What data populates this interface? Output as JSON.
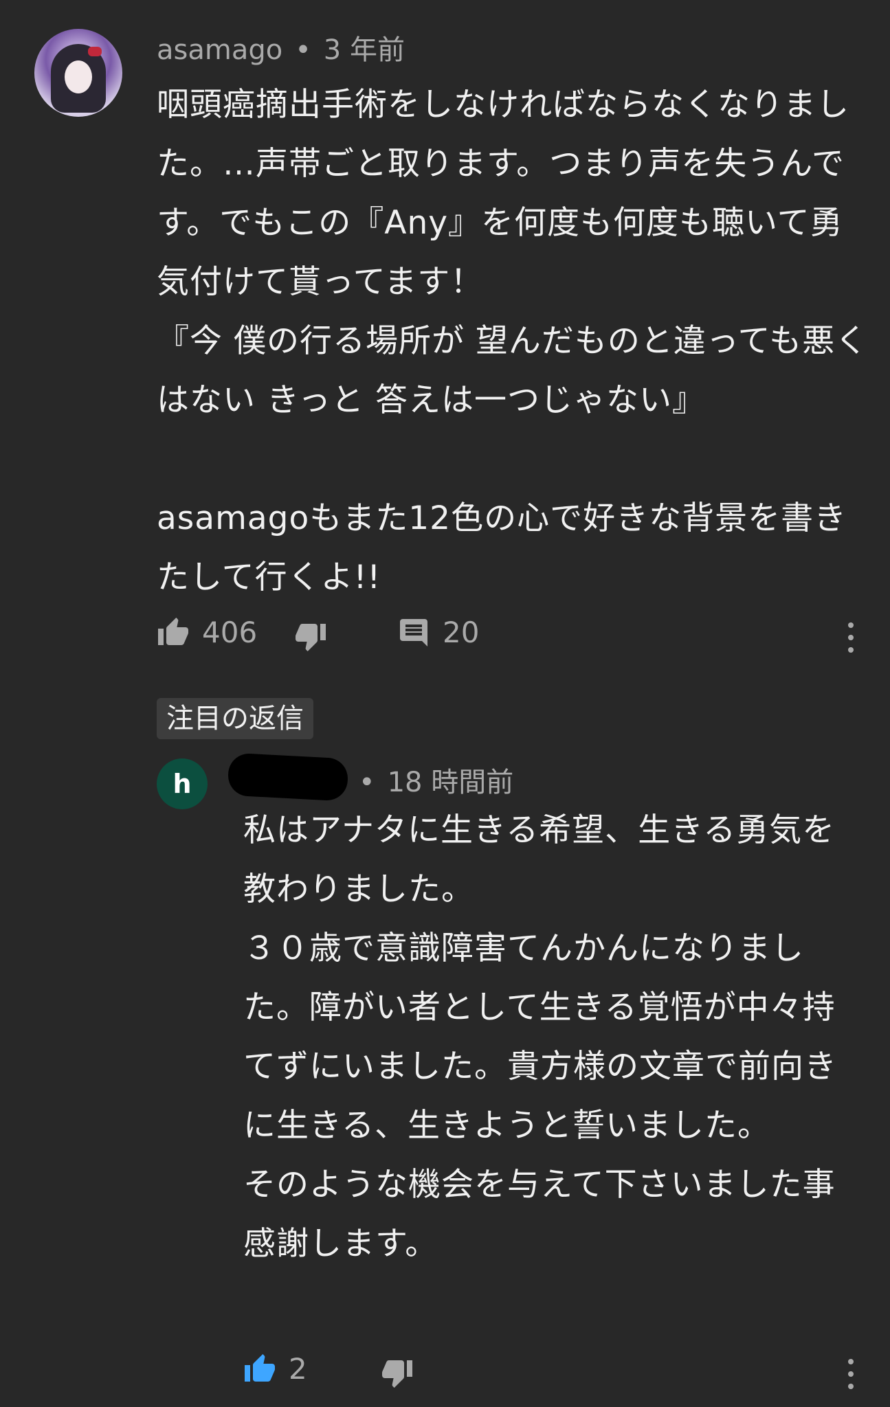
{
  "comment": {
    "author": "asamago",
    "separator": "•",
    "time": "3 年前",
    "text": "咽頭癌摘出手術をしなければならなくなりました。…声帯ごと取ります。つまり声を失うんです。でもこの『Any』を何度も何度も聴いて勇気付けて貰ってます！\n『今 僕の行る場所が 望んだものと違っても悪くはない きっと 答えは一つじゃない』\n\nasamagoもまた12色の心で好きな背景を書きたして行くよ!!",
    "likes": "406",
    "replies": "20",
    "icons": {
      "like": "thumbs-up-icon",
      "dislike": "thumbs-down-icon",
      "reply": "comment-icon",
      "more": "more-vert-icon"
    }
  },
  "featured_label": "注目の返信",
  "reply": {
    "avatar_letter": "h",
    "separator": "•",
    "time": "18 時間前",
    "text": "私はアナタに生きる希望、生きる勇気を教わりました。\n３０歳で意識障害てんかんになりました。障がい者として生きる覚悟が中々持てずにいました。貴方様の文章で前向きに生きる、生きようと誓いました。\nそのような機会を与えて下さいました事感謝します。",
    "likes": "2",
    "like_active_color": "#3ea6ff",
    "avatar_color": "#0c4f3f"
  }
}
